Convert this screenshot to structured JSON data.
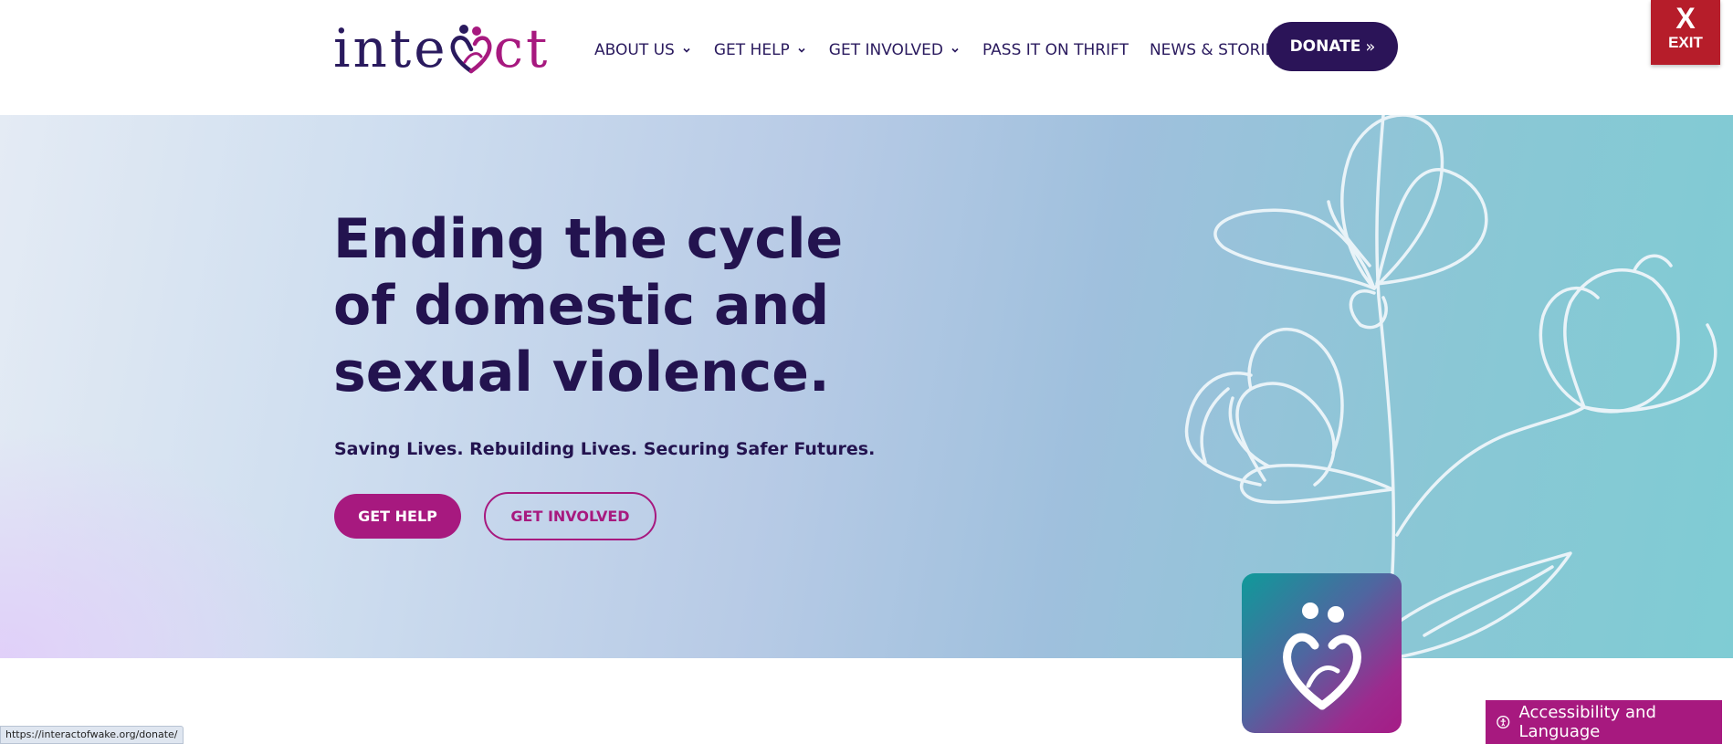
{
  "header": {
    "logo": {
      "left_text": "inte",
      "right_text": "ct",
      "alt": "interact"
    },
    "nav": [
      {
        "label": "ABOUT US",
        "has_dropdown": true
      },
      {
        "label": "GET HELP",
        "has_dropdown": true
      },
      {
        "label": "GET INVOLVED",
        "has_dropdown": true
      },
      {
        "label": "PASS IT ON THRIFT",
        "has_dropdown": false
      },
      {
        "label": "NEWS & STORIES",
        "has_dropdown": false
      }
    ],
    "donate_label": "DONATE",
    "donate_arrows": "»",
    "exit": {
      "x": "X",
      "label": "EXIT"
    }
  },
  "hero": {
    "title": "Ending the cycle of domestic and sexual violence.",
    "subtitle": "Saving Lives. Rebuilding Lives. Securing Safer Futures.",
    "get_help_label": "GET HELP",
    "get_involved_label": "GET INVOLVED",
    "decor_icon": "flower-line-art-icon",
    "badge_icon": "interact-heart-people-icon"
  },
  "status_bar": {
    "url": "https://interactofwake.org/donate/"
  },
  "accessibility": {
    "label": "Accessibility and Language",
    "icon": "accessibility-icon"
  },
  "colors": {
    "brand_navy": "#2b1458",
    "brand_magenta": "#a7197f",
    "exit_red": "#b61d2a",
    "hero_text": "#23134f"
  }
}
